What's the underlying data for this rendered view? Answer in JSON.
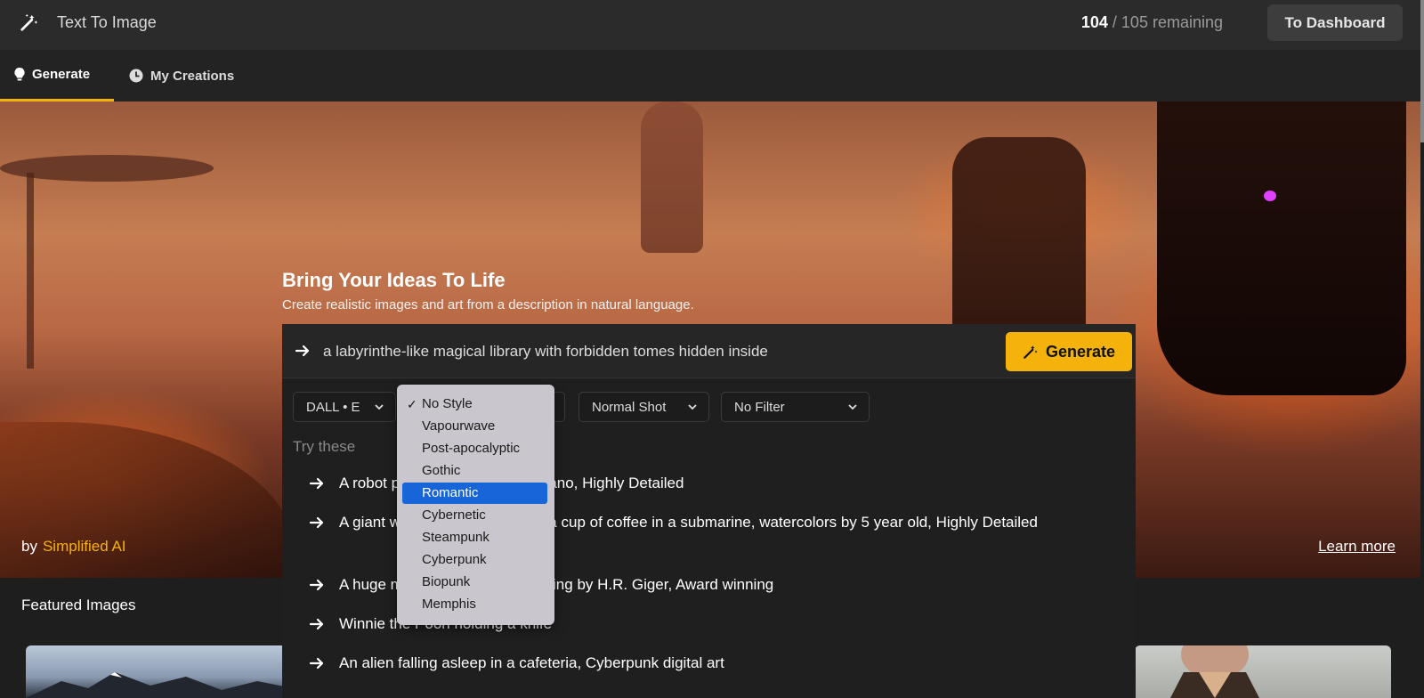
{
  "header": {
    "app_title": "Text To Image",
    "credits_used": "104",
    "credits_rest": " / 105 remaining",
    "dashboard_button": "To Dashboard"
  },
  "tabs": [
    {
      "label": "Generate",
      "icon": "bulb-icon",
      "active": true
    },
    {
      "label": "My Creations",
      "icon": "clock-icon",
      "active": false
    }
  ],
  "hero": {
    "title": "Bring Your Ideas To Life",
    "subtitle": "Create realistic images and art from a description in natural language.",
    "by_label": "by",
    "brand": "Simplified AI",
    "learn_more": "Learn more"
  },
  "prompt": {
    "value": "a labyrinthe-like magical library with forbidden tomes hidden inside",
    "generate_button": "Generate"
  },
  "selects": {
    "model": "DALL • E",
    "style": "No Style",
    "shot": "Normal Shot",
    "filter": "No Filter"
  },
  "style_dropdown": {
    "options": [
      "No Style",
      "Vapourwave",
      "Post-apocalyptic",
      "Gothic",
      "Romantic",
      "Cybernetic",
      "Steampunk",
      "Cyberpunk",
      "Biopunk",
      "Memphis"
    ],
    "checked": "No Style",
    "highlighted": "Romantic"
  },
  "suggestions": {
    "heading": "Try these",
    "items": [
      "A robot planting seeds in a volcano, Highly Detailed",
      "A giant wearing shoes drinking a cup of coffee in a submarine, watercolors by 5 year old, Highly Detailed",
      "A huge monster in a cave, Painting by H.R. Giger, Award winning",
      "Winnie the Pooh holding a knife",
      "An alien falling asleep in a cafeteria, Cyberpunk digital art"
    ]
  },
  "featured": {
    "heading": "Featured Images"
  },
  "colors": {
    "accent": "#f5b20b",
    "highlight": "#1765d8"
  }
}
